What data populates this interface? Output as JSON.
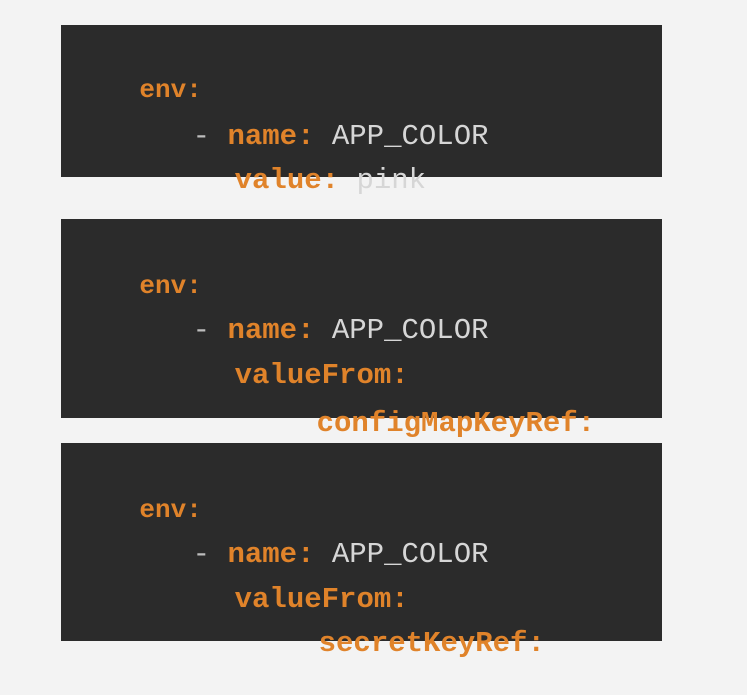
{
  "blocks": [
    {
      "lines": [
        {
          "key": "env",
          "colon": ":"
        },
        {
          "dash": "- ",
          "key": "name",
          "colon": ":",
          "value": " APP_COLOR"
        },
        {
          "key": "value",
          "colon": ":",
          "value": " pink"
        }
      ]
    },
    {
      "lines": [
        {
          "key": "env",
          "colon": ":"
        },
        {
          "dash": "- ",
          "key": "name",
          "colon": ":",
          "value": " APP_COLOR"
        },
        {
          "key": "valueFrom",
          "colon": ":"
        },
        {
          "key": "configMapKeyRef",
          "colon": ":"
        }
      ]
    },
    {
      "lines": [
        {
          "key": "env",
          "colon": ":"
        },
        {
          "dash": "- ",
          "key": "name",
          "colon": ":",
          "value": " APP_COLOR"
        },
        {
          "key": "valueFrom",
          "colon": ":"
        },
        {
          "key": "secretKeyRef",
          "colon": ":"
        }
      ]
    }
  ],
  "colors": {
    "background": "#f3f3f3",
    "block_background": "#2b2b2b",
    "key": "#e0832a",
    "value": "#d6d6d6",
    "dash": "#bdbdbd"
  }
}
